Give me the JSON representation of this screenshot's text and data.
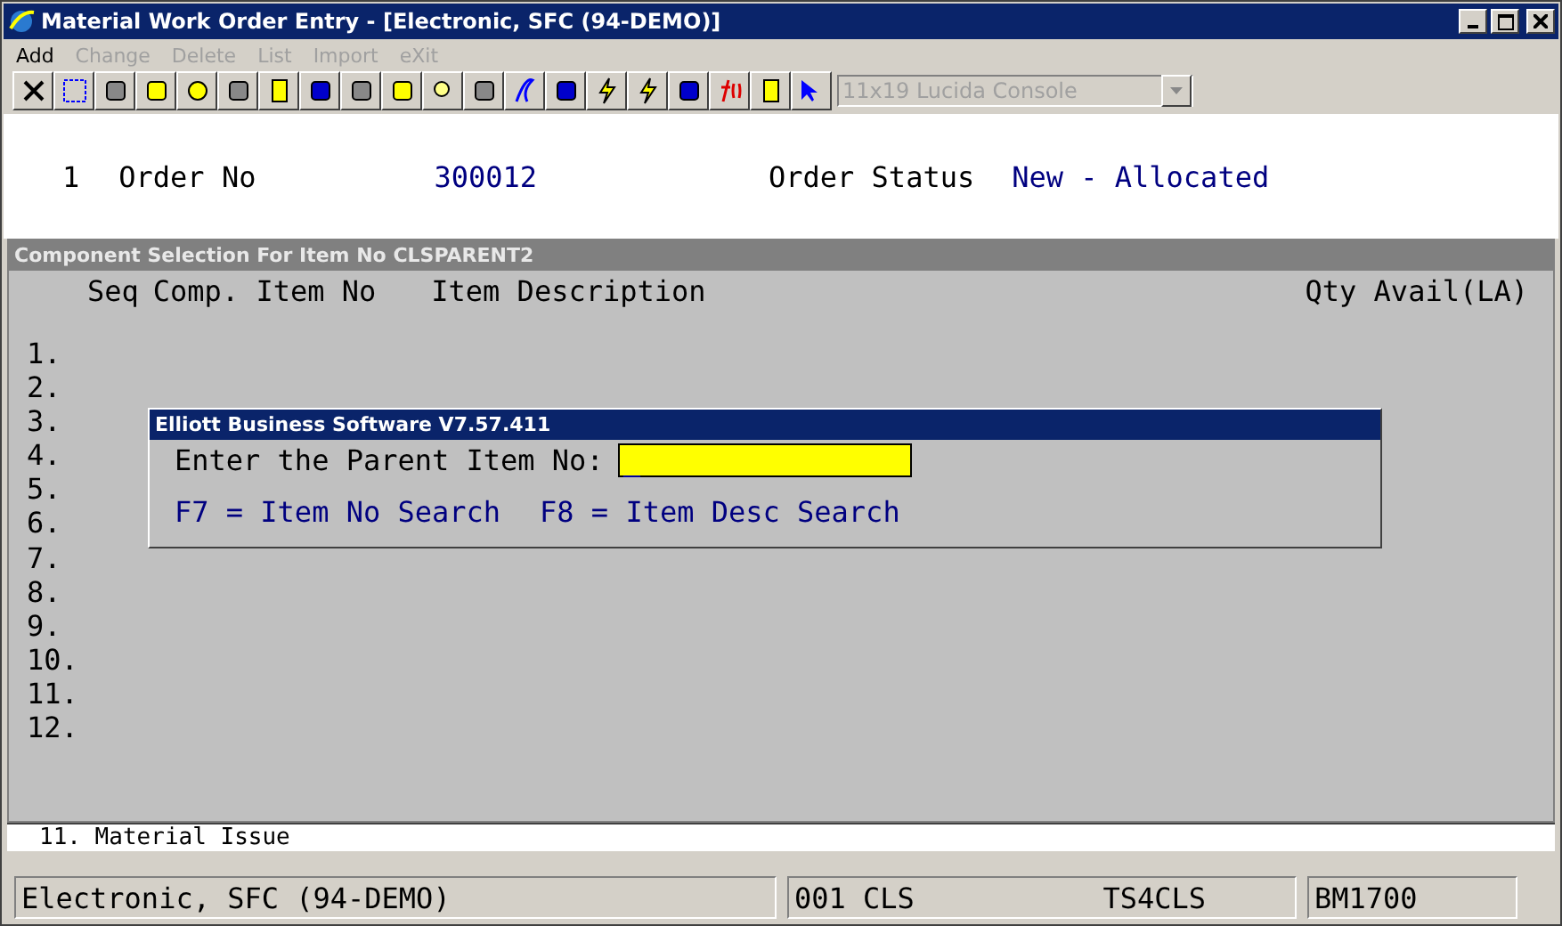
{
  "window": {
    "title": "Material Work Order Entry - [Electronic, SFC (94-DEMO)]"
  },
  "menu": [
    {
      "label": "Add",
      "disabled": false
    },
    {
      "label": "Change",
      "disabled": true
    },
    {
      "label": "Delete",
      "disabled": true
    },
    {
      "label": "List",
      "disabled": true
    },
    {
      "label": "Import",
      "disabled": true
    },
    {
      "label": "eXit",
      "disabled": true
    }
  ],
  "font_select": {
    "value": "11x19 Lucida Console",
    "disabled": true
  },
  "order": {
    "number": "1",
    "label": "Order No",
    "value": "300012",
    "status_label": "Order Status",
    "status": "New - Allocated"
  },
  "panel": {
    "title": "Component Selection For Item No CLSPARENT2",
    "columns": [
      "Seq",
      "Comp. Item No",
      "Item Description",
      "Qty Avail(LA)"
    ],
    "rows": [
      "1.",
      "2.",
      "3.",
      "4.",
      "5.",
      "6.",
      "7.",
      "8.",
      "9.",
      "10.",
      "11.",
      "12."
    ]
  },
  "dialog": {
    "title": "Elliott Business Software V7.57.411",
    "prompt": "Enter the Parent Item No:",
    "input_value": "_",
    "hints": [
      "F7 = Item No Search",
      "F8 = Item Desc Search"
    ]
  },
  "menu_line": "11. Material Issue",
  "status_bar": [
    "Electronic, SFC (94-DEMO)",
    "001 CLS",
    "TS4CLS",
    "BM1700"
  ]
}
